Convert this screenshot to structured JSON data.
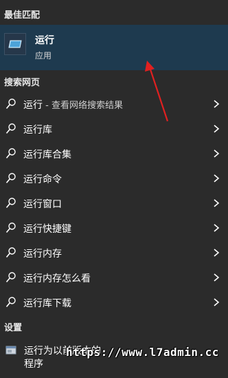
{
  "best_match": {
    "heading": "最佳匹配",
    "app_name": "运行",
    "app_type": "应用"
  },
  "web": {
    "heading": "搜索网页",
    "items": [
      {
        "label": "运行",
        "suffix": " - 查看网络搜索结果"
      },
      {
        "label": "运行库"
      },
      {
        "label": "运行库合集"
      },
      {
        "label": "运行命令"
      },
      {
        "label": "运行窗口"
      },
      {
        "label": "运行快捷键"
      },
      {
        "label": "运行内存"
      },
      {
        "label": "运行内存怎么看"
      },
      {
        "label": "运行库下载"
      }
    ]
  },
  "settings": {
    "heading": "设置",
    "item_line1": "运行为以前版本的",
    "item_line2": "程序"
  },
  "watermark": "https://www.l7admin.cc",
  "colors": {
    "background": "#2b2b2b",
    "highlight": "#1e3a4f",
    "arrow": "#e02020"
  }
}
